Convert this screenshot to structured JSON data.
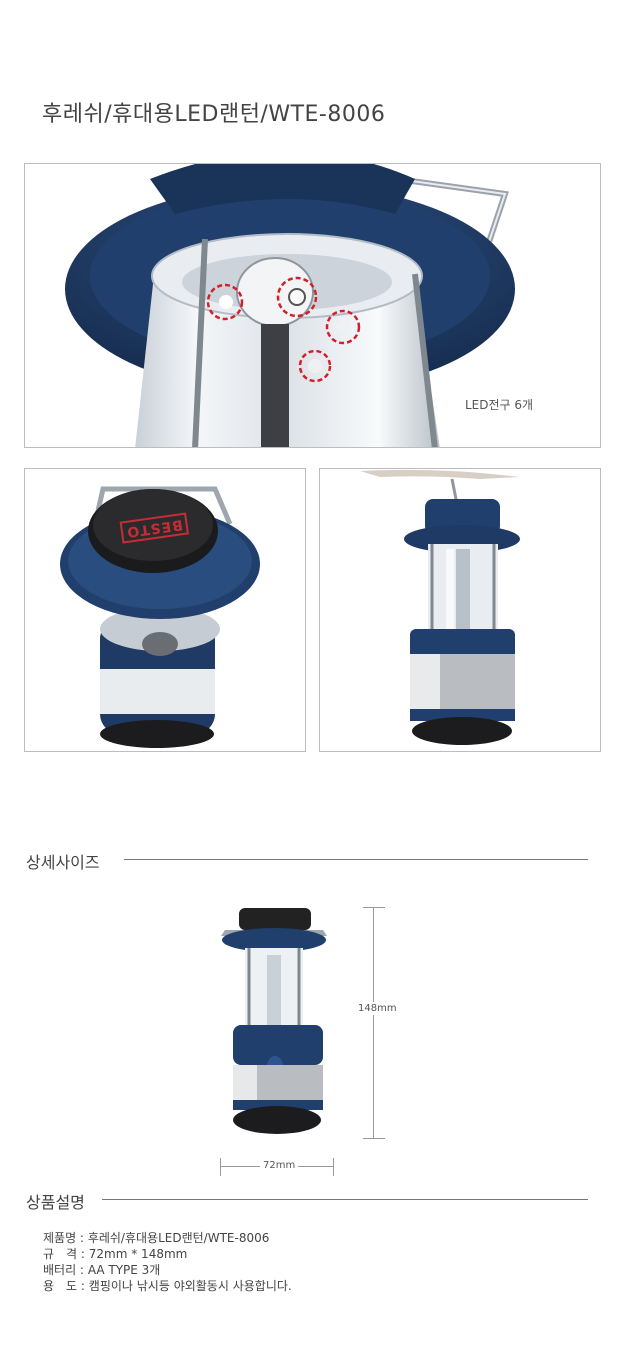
{
  "title": "후레쉬/휴대용LED랜턴/WTE-8006",
  "photo_top": {
    "caption": "LED전구 6개"
  },
  "photo_bottom_left": {
    "logo_text": "BESTO"
  },
  "size_section": {
    "heading": "상세사이즈",
    "height_label": "148mm",
    "width_label": "72mm"
  },
  "info_section": {
    "heading": "상품설명",
    "rows": [
      {
        "key": "제품명 :",
        "value": "후레쉬/휴대용LED랜턴/WTE-8006"
      },
      {
        "key": "규　격 :",
        "value": "72mm * 148mm"
      },
      {
        "key": "배터리 :",
        "value": "AA TYPE 3개"
      },
      {
        "key": "용　도 :",
        "value": "캠핑이나 낚시등 야외활동시 사용합니다."
      }
    ]
  },
  "colors": {
    "lantern_blue": "#1f3a64",
    "lantern_dark": "#1c1c1e",
    "silver": "#b9bdc1",
    "marker_red": "#d0202a"
  }
}
